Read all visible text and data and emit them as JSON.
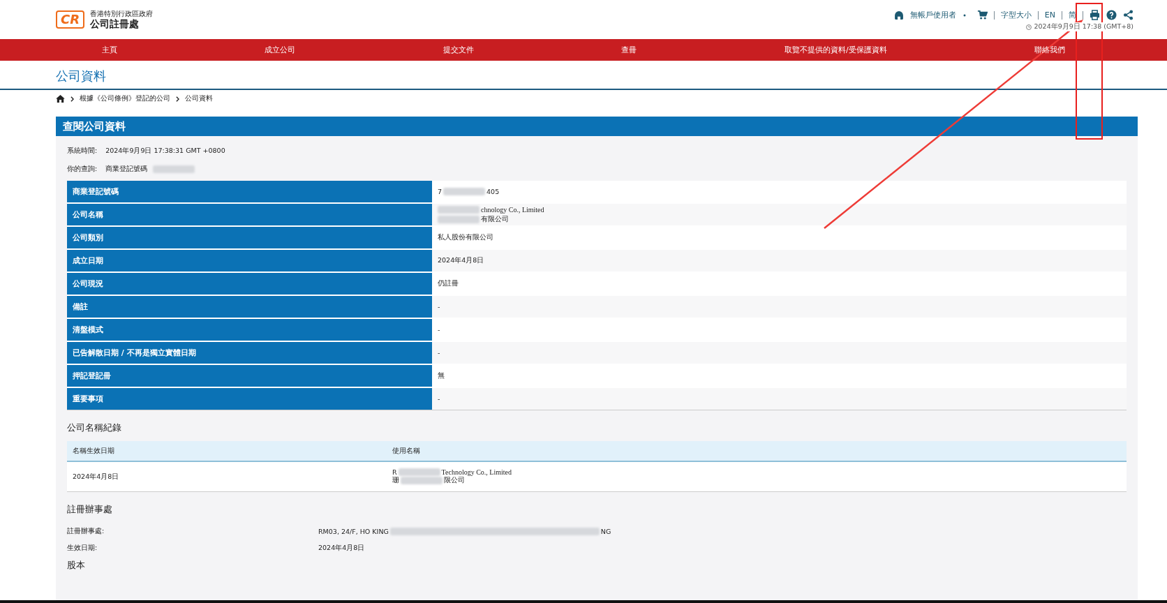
{
  "header": {
    "logo": "CR",
    "gov": "香港特別行政區政府",
    "agency": "公司註冊處",
    "user": "無帳戶使用者",
    "links": [
      "字型大小",
      "EN",
      "简"
    ],
    "time": "2024年9月9日 17:38 (GMT+8)"
  },
  "nav": [
    "主頁",
    "成立公司",
    "提交文件",
    "查冊",
    "取覽不提供的資料/受保護資料",
    "聯絡我們"
  ],
  "page_title": "公司資料",
  "breadcrumb": [
    "根據《公司條例》登記的公司",
    "公司資料"
  ],
  "panel": {
    "title": "查閱公司資料",
    "meta": [
      {
        "label": "系統時間:",
        "segments": [
          {
            "kind": "text",
            "text": "2024年9月9日 17:38:31 GMT +0800"
          }
        ]
      },
      {
        "label": "你的查詢:",
        "segments": [
          {
            "kind": "text",
            "text": "商業登記號碼"
          },
          {
            "kind": "blur"
          }
        ]
      }
    ],
    "rows": [
      {
        "label": "商業登記號碼",
        "lines": [
          [
            {
              "kind": "text",
              "text": "7"
            },
            {
              "kind": "blur"
            },
            {
              "kind": "text",
              "text": "405"
            }
          ]
        ]
      },
      {
        "label": "公司名稱",
        "lines": [
          [
            {
              "kind": "blur"
            },
            {
              "kind": "text",
              "text": "chnology Co., Limited"
            }
          ],
          [
            {
              "kind": "blur"
            },
            {
              "kind": "text",
              "text": "有限公司"
            }
          ]
        ]
      },
      {
        "label": "公司類別",
        "lines": [
          [
            {
              "kind": "text",
              "text": "私人股份有限公司"
            }
          ]
        ]
      },
      {
        "label": "成立日期",
        "lines": [
          [
            {
              "kind": "text",
              "text": "2024年4月8日"
            }
          ]
        ]
      },
      {
        "label": "公司現況",
        "lines": [
          [
            {
              "kind": "text",
              "text": "仍註冊"
            }
          ]
        ]
      },
      {
        "label": "備註",
        "lines": [
          [
            {
              "kind": "text",
              "text": "-"
            }
          ]
        ]
      },
      {
        "label": "清盤模式",
        "lines": [
          [
            {
              "kind": "text",
              "text": "-"
            }
          ]
        ]
      },
      {
        "label": "已告解散日期 / 不再是獨立實體日期",
        "lines": [
          [
            {
              "kind": "text",
              "text": "-"
            }
          ]
        ]
      },
      {
        "label": "押記登記冊",
        "lines": [
          [
            {
              "kind": "text",
              "text": "無"
            }
          ]
        ]
      },
      {
        "label": "重要事項",
        "lines": [
          [
            {
              "kind": "text",
              "text": "-"
            }
          ]
        ]
      }
    ],
    "name_history": {
      "title": "公司名稱紀錄",
      "columns": [
        "名稱生效日期",
        "使用名稱"
      ],
      "rows": [
        {
          "date": "2024年4月8日",
          "lines": [
            [
              {
                "kind": "text",
                "text": "R"
              },
              {
                "kind": "blur"
              },
              {
                "kind": "text",
                "text": "Technology Co., Limited"
              }
            ],
            [
              {
                "kind": "text",
                "text": "珊"
              },
              {
                "kind": "blur"
              },
              {
                "kind": "text",
                "text": "限公司"
              }
            ]
          ]
        }
      ]
    },
    "office": {
      "title": "註冊辦事處",
      "fields": [
        {
          "label": "註冊辦事處:",
          "segments": [
            {
              "kind": "text",
              "text": "RM03, 24/F, HO KING"
            },
            {
              "kind": "blur"
            },
            {
              "kind": "text",
              "text": "NG"
            }
          ]
        },
        {
          "label": "生效日期:",
          "segments": [
            {
              "kind": "text",
              "text": "2024年4月8日"
            }
          ]
        }
      ]
    },
    "next_title": "股本"
  }
}
